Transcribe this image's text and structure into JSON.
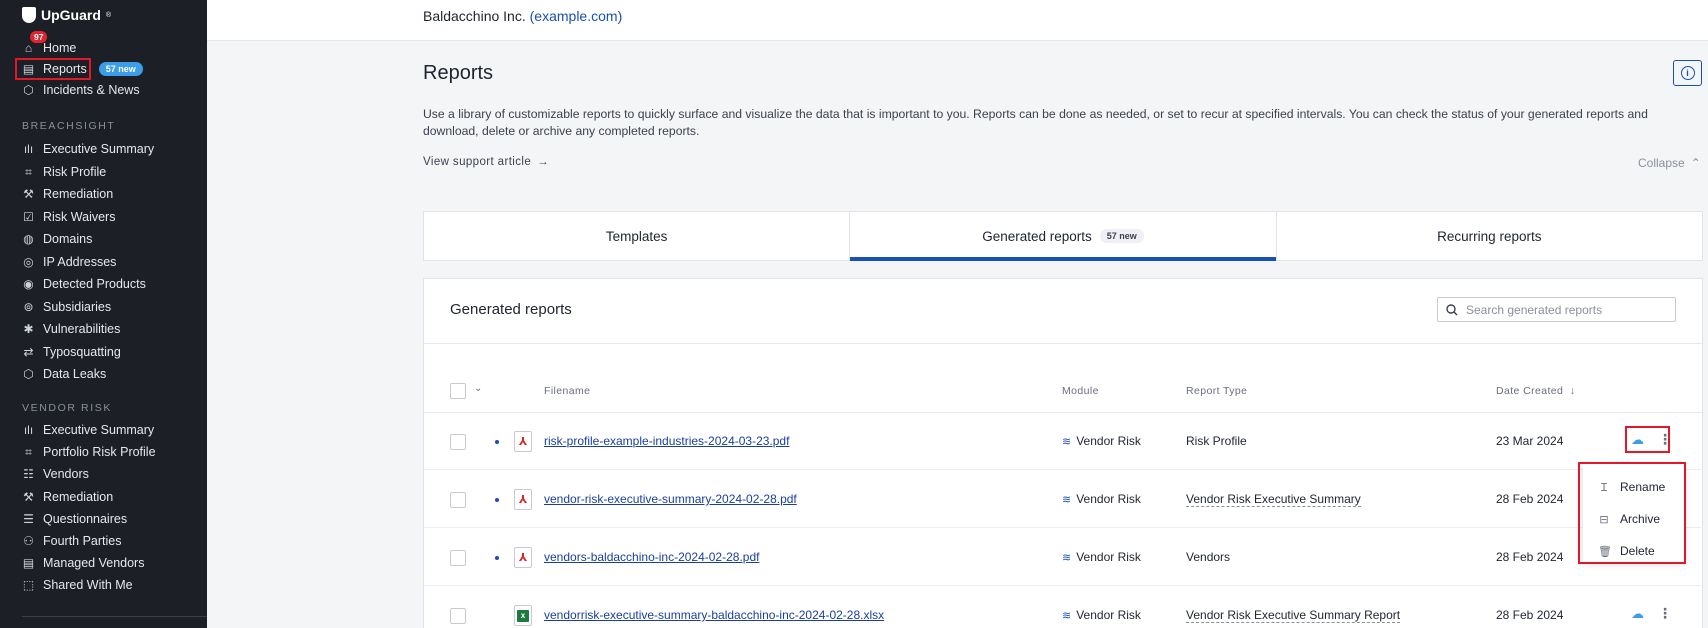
{
  "sidebar": {
    "logo": "UpGuard",
    "logo_tm": "®",
    "notification_count": "97",
    "items": [
      {
        "label": "Home",
        "icon": "home-icon",
        "glyph": "⌂"
      },
      {
        "label": "Reports",
        "icon": "report-icon",
        "glyph": "▤",
        "badge": "57 new"
      },
      {
        "label": "Incidents & News",
        "icon": "incidents-icon",
        "glyph": "⬡"
      }
    ],
    "breachsight_label": "BREACHSIGHT",
    "breachsight": [
      {
        "label": "Executive Summary",
        "icon": "bar-chart-icon",
        "glyph": "ılı"
      },
      {
        "label": "Risk Profile",
        "icon": "risk-profile-icon",
        "glyph": "⌗"
      },
      {
        "label": "Remediation",
        "icon": "wrench-icon",
        "glyph": "⚒"
      },
      {
        "label": "Risk Waivers",
        "icon": "checkbox-icon",
        "glyph": "☑"
      },
      {
        "label": "Domains",
        "icon": "globe-icon",
        "glyph": "◍"
      },
      {
        "label": "IP Addresses",
        "icon": "ip-globe-icon",
        "glyph": "◎"
      },
      {
        "label": "Detected Products",
        "icon": "detected-products-icon",
        "glyph": "◉"
      },
      {
        "label": "Subsidiaries",
        "icon": "subsidiaries-icon",
        "glyph": "⊚"
      },
      {
        "label": "Vulnerabilities",
        "icon": "bug-icon",
        "glyph": "✱"
      },
      {
        "label": "Typosquatting",
        "icon": "typosquatting-icon",
        "glyph": "⇄"
      },
      {
        "label": "Data Leaks",
        "icon": "data-leaks-icon",
        "glyph": "⬡"
      }
    ],
    "vendor_risk_label": "VENDOR RISK",
    "vendor_risk": [
      {
        "label": "Executive Summary",
        "icon": "bar-chart-icon",
        "glyph": "ılı"
      },
      {
        "label": "Portfolio Risk Profile",
        "icon": "portfolio-icon",
        "glyph": "⌗"
      },
      {
        "label": "Vendors",
        "icon": "vendors-list-icon",
        "glyph": "☷"
      },
      {
        "label": "Remediation",
        "icon": "wrench-icon",
        "glyph": "⚒"
      },
      {
        "label": "Questionnaires",
        "icon": "questionnaire-icon",
        "glyph": "☰"
      },
      {
        "label": "Fourth Parties",
        "icon": "fourth-parties-icon",
        "glyph": "⚇"
      },
      {
        "label": "Managed Vendors",
        "icon": "managed-vendors-icon",
        "glyph": "▤"
      },
      {
        "label": "Shared With Me",
        "icon": "shared-icon",
        "glyph": "⬚"
      }
    ]
  },
  "header": {
    "company": "Baldacchino Inc.",
    "domain": "example.com"
  },
  "page": {
    "title": "Reports",
    "description": "Use a library of customizable reports to quickly surface and visualize the data that is important to you. Reports can be done as needed, or set to recur at specified intervals. You can check the status of your generated reports and download, delete or archive any completed reports.",
    "support_link": "View support article",
    "collapse": "Collapse"
  },
  "tabs": [
    {
      "label": "Templates"
    },
    {
      "label": "Generated reports",
      "badge": "57 new",
      "active": true
    },
    {
      "label": "Recurring reports"
    }
  ],
  "card": {
    "title": "Generated reports",
    "search_placeholder": "Search generated reports",
    "columns": {
      "filename": "Filename",
      "module": "Module",
      "report_type": "Report Type",
      "date_created": "Date Created"
    },
    "rows": [
      {
        "filename": "risk-profile-example-industries-2024-03-23.pdf",
        "type": "pdf",
        "unread": true,
        "module": "Vendor Risk",
        "report_type": "Risk Profile",
        "date": "23 Mar 2024"
      },
      {
        "filename": "vendor-risk-executive-summary-2024-02-28.pdf",
        "type": "pdf",
        "unread": true,
        "module": "Vendor Risk",
        "report_type": "Vendor Risk Executive Summary",
        "date": "28 Feb 2024"
      },
      {
        "filename": "vendors-baldacchino-inc-2024-02-28.pdf",
        "type": "pdf",
        "unread": true,
        "module": "Vendor Risk",
        "report_type": "Vendors",
        "date": "28 Feb 2024"
      },
      {
        "filename": "vendorrisk-executive-summary-baldacchino-inc-2024-02-28.xlsx",
        "type": "xlsx",
        "unread": false,
        "module": "Vendor Risk",
        "report_type": "Vendor Risk Executive Summary Report",
        "date": "28 Feb 2024"
      }
    ]
  },
  "menu": {
    "items": [
      {
        "label": "Rename",
        "icon": "rename-icon"
      },
      {
        "label": "Archive",
        "icon": "archive-icon"
      },
      {
        "label": "Delete",
        "icon": "trash-icon"
      }
    ]
  },
  "colors": {
    "sidebar_bg": "#1c1f26",
    "accent": "#1a4fb5",
    "highlight": "#e3172a",
    "badge_blue": "#3b9ee8",
    "notification_red": "#e0242f"
  }
}
